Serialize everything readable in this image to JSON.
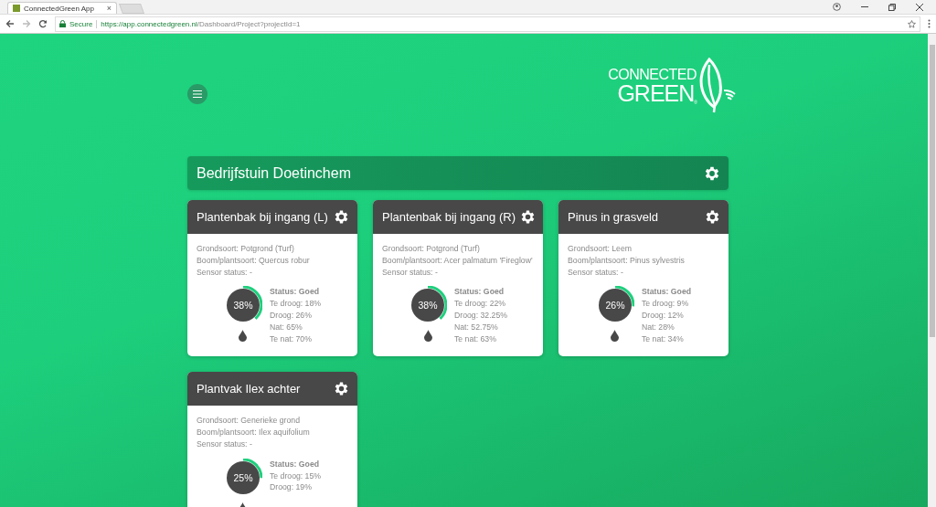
{
  "browser": {
    "tab_title": "ConnectedGreen App",
    "tab_close": "×",
    "secure_label": "Secure",
    "url_host": "https://app.connectedgreen.nl",
    "url_path": "/Dashboard/Project?projectId=1"
  },
  "logo": {
    "line_1": "CONNECTED",
    "line_2": "GREEN",
    "mark": "®"
  },
  "project": {
    "title": "Bedrijfstuin Doetinchem"
  },
  "cards": [
    {
      "title": "Plantenbak bij ingang (L)",
      "details": [
        "Grondsoort: Potgrond (Turf)",
        "Boom/plantsoort: Quercus robur",
        "Sensor status: -"
      ],
      "percent": "38%",
      "level": 0.38,
      "status": "Status: Goed",
      "lines": [
        "Te droog: 18%",
        "Droog: 26%",
        "Nat: 65%",
        "Te nat: 70%"
      ]
    },
    {
      "title": "Plantenbak bij ingang (R)",
      "details": [
        "Grondsoort: Potgrond (Turf)",
        "Boom/plantsoort: Acer palmatum 'Fireglow'",
        "Sensor status: -"
      ],
      "percent": "38%",
      "level": 0.38,
      "status": "Status: Goed",
      "lines": [
        "Te droog: 22%",
        "Droog: 32.25%",
        "Nat: 52.75%",
        "Te nat: 63%"
      ]
    },
    {
      "title": "Pinus in grasveld",
      "details": [
        "Grondsoort: Leem",
        "Boom/plantsoort: Pinus sylvestris",
        "Sensor status: -"
      ],
      "percent": "26%",
      "level": 0.26,
      "status": "Status: Goed",
      "lines": [
        "Te droog: 9%",
        "Droog: 12%",
        "Nat: 28%",
        "Te nat: 34%"
      ]
    },
    {
      "title": "Plantvak Ilex achter",
      "details": [
        "Grondsoort: Generieke grond",
        "Boom/plantsoort: Ilex aquifolium",
        "Sensor status: -"
      ],
      "percent": "25%",
      "level": 0.25,
      "status": "Status: Goed",
      "lines": [
        "Te droog: 15%",
        "Droog: 19%"
      ]
    }
  ]
}
